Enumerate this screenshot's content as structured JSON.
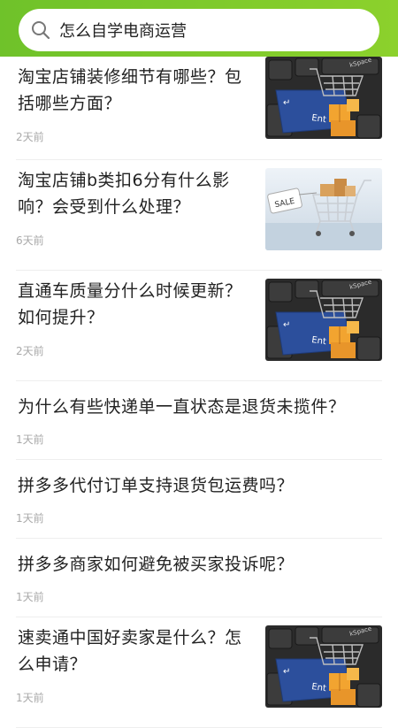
{
  "search": {
    "query": "怎么自学电商运营",
    "icon": "search-icon"
  },
  "items": [
    {
      "title": "淘宝店铺装修细节有哪些？包括哪些方面？",
      "time": "2天前",
      "thumb": "keyboard-cart-image"
    },
    {
      "title": "淘宝店铺b类扣6分有什么影响？会受到什么处理？",
      "time": "6天前",
      "thumb": "sale-cart-image"
    },
    {
      "title": "直通车质量分什么时候更新？如何提升？",
      "time": "2天前",
      "thumb": "keyboard-cart-image"
    },
    {
      "title": "为什么有些快递单一直状态是退货未揽件？",
      "time": "1天前"
    },
    {
      "title": "拼多多代付订单支持退货包运费吗？",
      "time": "1天前"
    },
    {
      "title": "拼多多商家如何避免被买家投诉呢？",
      "time": "1天前"
    },
    {
      "title": "速卖通中国好卖家是什么？怎么申请？",
      "time": "1天前",
      "thumb": "keyboard-cart-image"
    }
  ]
}
